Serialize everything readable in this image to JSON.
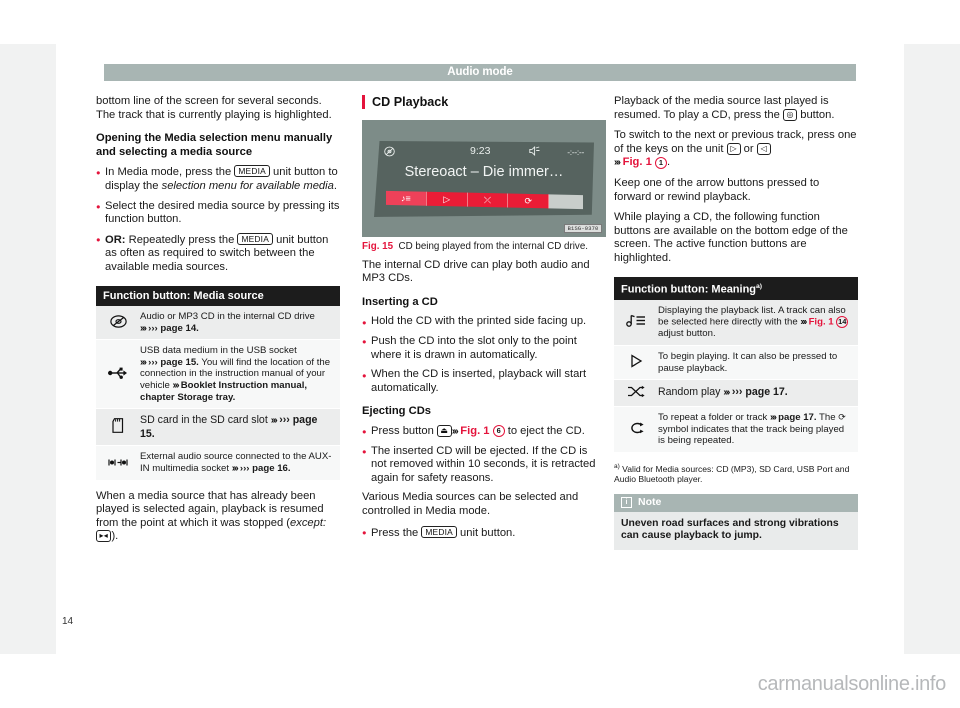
{
  "header": {
    "title": "Audio mode"
  },
  "page_number": "14",
  "watermark": "carmanualsonline.info",
  "left_column": {
    "continued_paragraph": "bottom line of the screen for several seconds. The track that is currently playing is highlighted.",
    "heading": "Opening the Media selection menu manually and selecting a media source",
    "bullets": [
      {
        "pre": "In Media mode, press the ",
        "key": "MEDIA",
        "post": " unit button to display the ",
        "italic": "selection menu for available media",
        "tail": "."
      },
      {
        "pre": "Select the desired media source by pressing its function button.",
        "key": "",
        "post": "",
        "italic": "",
        "tail": ""
      },
      {
        "bold_lead": "OR:",
        "pre": " Repeatedly press the ",
        "key": "MEDIA",
        "post": " unit button as often as required to switch between the available media sources.",
        "italic": "",
        "tail": ""
      }
    ],
    "table": {
      "header": "Function button: Media source",
      "rows": [
        {
          "icon": "cd-disc-icon",
          "glyph": "◎",
          "text": "Audio or MP3 CD in the internal CD drive ››› page 14.",
          "text_plain": "Audio or MP3 CD in the internal CD drive",
          "ref": "››› page 14."
        },
        {
          "icon": "usb-icon",
          "glyph": "⛛",
          "text": "USB data medium in the USB socket ››› page 15. You will find the location of the connection in the instruction manual of your vehicle ››› Booklet Instruction manual, chapter Storage tray.",
          "text_plain": "USB data medium in the USB socket",
          "ref": "››› page 15."
        },
        {
          "icon": "sd-card-icon",
          "glyph": "▯",
          "text": "SD card in the SD card slot ››› page 15.",
          "text_plain": "SD card in the SD card slot",
          "ref": "››› page 15."
        },
        {
          "icon": "aux-in-icon",
          "glyph": "◈",
          "text": "External audio source connected to the AUX-IN multimedia socket ››› page 16.",
          "text_plain": "External audio source connected to the AUX-IN multimedia socket",
          "ref": "››› page 16."
        }
      ]
    },
    "closing_paragraph_pre": "When a media source that has already been played is selected again, playback is resumed from the point at which it was stopped (",
    "closing_italic": "except:",
    "closing_key": "▸◂",
    "closing_paragraph_post": ")."
  },
  "middle_column": {
    "section_title": "CD Playback",
    "figure": {
      "label": "Fig. 15",
      "caption": "CD being played from the internal CD drive.",
      "image_id": "B1SG-0370",
      "screen": {
        "time": "9:23",
        "elapsed": "-:--:--",
        "track_title": "Stereoact – Die immer…",
        "disc_icon": "cd-disc-icon",
        "mute_icon": "mute-speaker-icon",
        "buttons": [
          {
            "name": "playback-list-button",
            "glyph": "♪≡",
            "active": true
          },
          {
            "name": "play-button",
            "glyph": "▷",
            "active": true
          },
          {
            "name": "random-play-button",
            "glyph": "⤫",
            "active": true
          },
          {
            "name": "repeat-button",
            "glyph": "⟳",
            "active": true
          },
          {
            "name": "inactive-segment",
            "glyph": "",
            "active": false
          }
        ]
      }
    },
    "intro": "The internal CD drive can play both audio and MP3 CDs.",
    "heading_insert": "Inserting a CD",
    "insert_bullets": [
      "Hold the CD with the printed side facing up.",
      "Push the CD into the slot only to the point where it is drawn in automatically.",
      "When the CD is inserted, playback will start automatically."
    ],
    "heading_eject": "Ejecting CDs",
    "eject_bullet_1": {
      "pre": "Press button ",
      "key": "⏏",
      "mid": " ",
      "ref": "Fig. 1",
      "circle": "6",
      "post": " to eject the CD."
    },
    "eject_bullet_2": "The inserted CD will be ejected. If the CD is not removed within 10 seconds, it is retracted again for safety reasons.",
    "paragraph_various": "Various Media sources can be selected and controlled in Media mode.",
    "press_media_bullet": {
      "pre": "Press the ",
      "key": "MEDIA",
      "post": " unit button."
    }
  },
  "right_column": {
    "paragraph_1": {
      "pre": "Playback of the media source last played is resumed. To play a CD, press the ",
      "key": "◎",
      "post": " button."
    },
    "paragraph_2": {
      "pre": "To switch to the next or previous track, press one of the keys on the unit ",
      "key_next": "▷",
      "or": " or ",
      "key_prev": "◁",
      "ref": "Fig. 1",
      "circle": "1",
      "post": "."
    },
    "paragraph_3": "Keep one of the arrow buttons pressed to forward or rewind playback.",
    "paragraph_4": "While playing a CD, the following function buttons are available on the bottom edge of the screen. The active function buttons are highlighted.",
    "table": {
      "header": "Function button: Meaning",
      "header_superscript": "a)",
      "rows": [
        {
          "icon": "playback-list-icon",
          "glyph": "♪≡",
          "text_a": "Displaying the playback list. A track can also be selected here directly with the ",
          "ref": "Fig. 1",
          "circle": "14",
          "text_b": " adjust button."
        },
        {
          "icon": "play-icon",
          "glyph": "▷",
          "text_a": "To begin playing. It can also be pressed to pause playback.",
          "ref": "",
          "circle": "",
          "text_b": ""
        },
        {
          "icon": "random-play-icon",
          "glyph": "⤫",
          "text_a": "Random play ",
          "ref": "",
          "circle": "",
          "text_b": "››› page 17."
        },
        {
          "icon": "repeat-icon",
          "glyph": "⟳",
          "text_a": "To repeat a folder or track ››› page 17. The ⟳ symbol indicates that the track being played is being repeated.",
          "ref": "",
          "circle": "",
          "text_b": ""
        }
      ]
    },
    "footnote": {
      "marker": "a)",
      "text": "Valid for Media sources: CD (MP3), SD Card, USB Port and Audio Bluetooth player."
    },
    "note": {
      "icon": "info-icon",
      "title": "Note",
      "body": "Uneven road surfaces and strong vibrations can cause playback to jump."
    }
  },
  "colors": {
    "accent_red": "#e4143c",
    "header_gray": "#a8b5b3",
    "table_header_black": "#1c1c1c",
    "screen_bg": "#56635f",
    "screen_button_red": "#ea1c36"
  }
}
